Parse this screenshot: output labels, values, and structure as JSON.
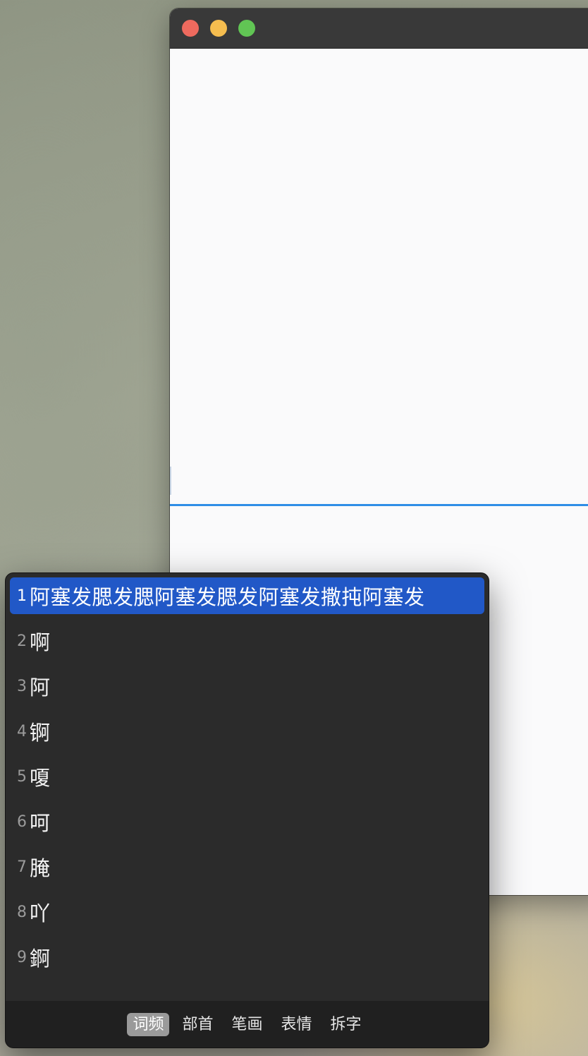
{
  "colors": {
    "traffic_close": "#ee6a5e",
    "traffic_minimize": "#f5bd4f",
    "traffic_zoom": "#61c554",
    "selection": "#2158c7",
    "divider_accent": "#2f8ee6"
  },
  "candidates": [
    {
      "num": "1",
      "text": "阿塞发腮发腮阿塞发腮发阿塞发撒扽阿塞发"
    },
    {
      "num": "2",
      "text": "啊"
    },
    {
      "num": "3",
      "text": "阿"
    },
    {
      "num": "4",
      "text": "锕"
    },
    {
      "num": "5",
      "text": "嗄"
    },
    {
      "num": "6",
      "text": "呵"
    },
    {
      "num": "7",
      "text": "腌"
    },
    {
      "num": "8",
      "text": "吖"
    },
    {
      "num": "9",
      "text": "錒"
    }
  ],
  "mode_tabs": [
    {
      "label": "词频",
      "active": true
    },
    {
      "label": "部首",
      "active": false
    },
    {
      "label": "笔画",
      "active": false
    },
    {
      "label": "表情",
      "active": false
    },
    {
      "label": "拆字",
      "active": false
    }
  ]
}
